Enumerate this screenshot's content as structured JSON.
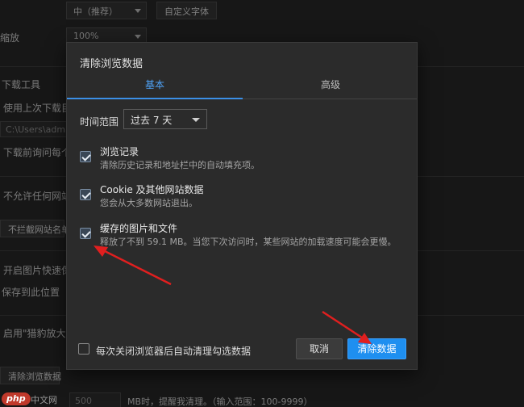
{
  "background": {
    "font_size_select": "中（推荐）",
    "custom_font_button": "自定义字体",
    "zoom_label": "缩放",
    "zoom_select": "100%",
    "download_tool_label": "下载工具",
    "use_last_download_dir": "使用上次下载目",
    "download_path": "C:\\Users\\adm",
    "ask_before_download": "下载前询问每个",
    "disallow_sites": "不允许任何网站",
    "block_list_button": "不拦截网站名单",
    "image_quick_save": "开启图片快速保",
    "save_location": "保存到此位置",
    "enable_mouse": "启用\"猎豹放大镜",
    "clear_data_button": "清除浏览数据",
    "mb_label": "MB时，提醒我清理。（输入范围：100-9999）",
    "mb_value": "500"
  },
  "dialog": {
    "title": "清除浏览数据",
    "tabs": [
      {
        "label": "基本",
        "active": true
      },
      {
        "label": "高级",
        "active": false
      }
    ],
    "time_range_label": "时间范围",
    "time_range_value": "过去 7 天",
    "options": [
      {
        "title": "浏览记录",
        "desc": "清除历史记录和地址栏中的自动填充项。",
        "checked": true
      },
      {
        "title": "Cookie 及其他网站数据",
        "desc": "您会从大多数网站退出。",
        "checked": true
      },
      {
        "title": "缓存的图片和文件",
        "desc": "释放了不到 59.1 MB。当您下次访问时，某些网站的加载速度可能会更慢。",
        "checked": true
      }
    ],
    "auto_clear_label": "每次关闭浏览器后自动清理勾选数据",
    "auto_clear_checked": false,
    "cancel_label": "取消",
    "clear_label": "清除数据"
  },
  "watermark": {
    "logo_text": "php",
    "logo_cn": "中文网"
  },
  "colors": {
    "accent": "#1e8ff0",
    "arrow": "#e01f1f"
  }
}
